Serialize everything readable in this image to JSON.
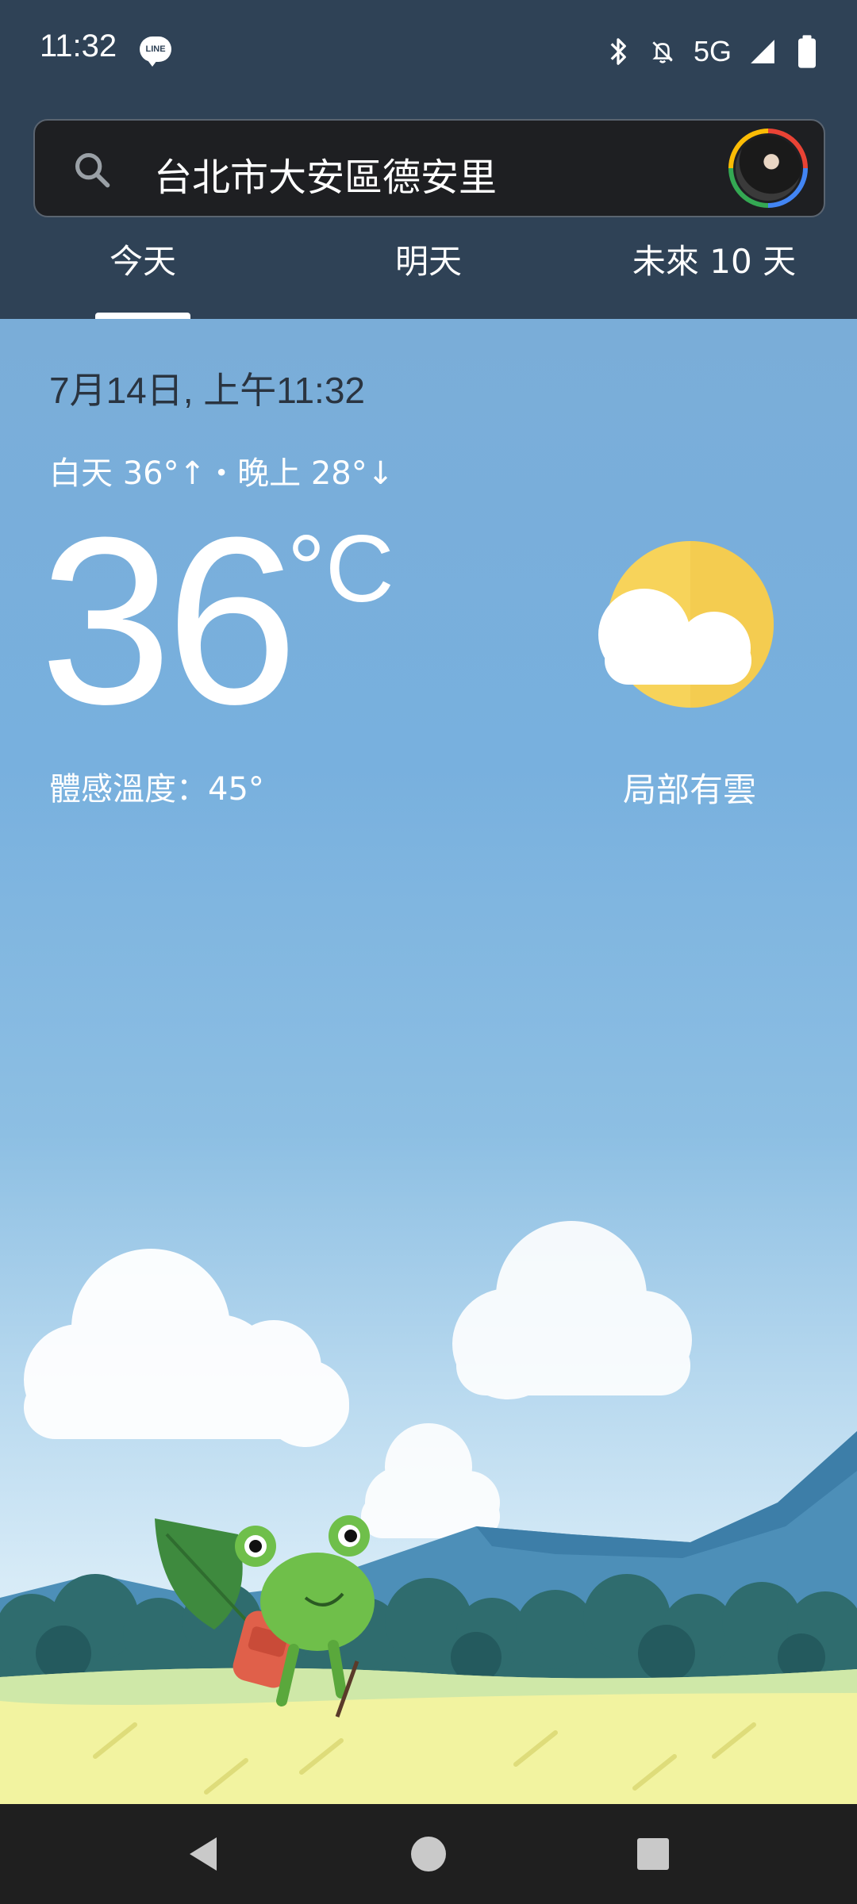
{
  "status_bar": {
    "time": "11:32",
    "notification_icon": "line-app-icon",
    "line_label": "LINE",
    "network": "5G",
    "icons": [
      "bluetooth-icon",
      "notifications-off-icon",
      "signal-icon",
      "battery-icon"
    ]
  },
  "search": {
    "icon": "search-icon",
    "location": "台北市大安區德安里"
  },
  "tabs": [
    {
      "label": "今天",
      "active": true
    },
    {
      "label": "明天",
      "active": false
    },
    {
      "label": "未來 10 天",
      "active": false
    }
  ],
  "weather": {
    "datetime": "7月14日, 上午11:32",
    "high_low": "白天 36°↑・晚上 28°↓",
    "temperature": "36",
    "unit": "°C",
    "feels_like": "體感溫度：45°",
    "condition": "局部有雲",
    "condition_icon": "partly-cloudy-icon"
  },
  "nav": {
    "buttons": [
      "back-icon",
      "home-icon",
      "recents-icon"
    ]
  },
  "colors": {
    "header_bg": "#2f4256",
    "sky_top": "#7aadd8",
    "sun": "#f7d35a",
    "nav_bg": "#1f1f1f"
  }
}
